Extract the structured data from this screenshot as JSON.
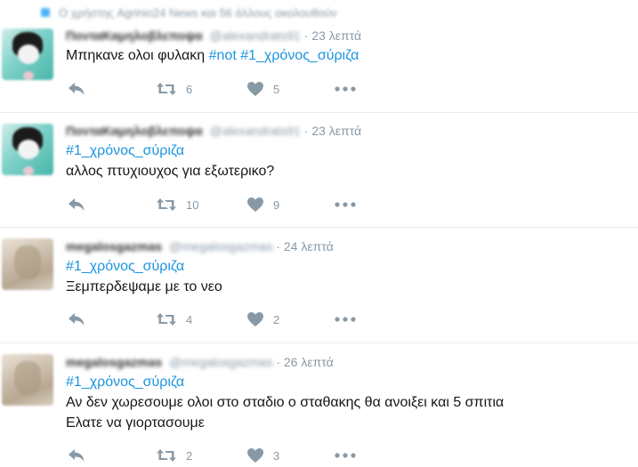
{
  "context": {
    "text": "Ο χρήστης Agrinio24 News και 56 άλλους ακολουθούν"
  },
  "colors": {
    "hashtag": "#1b95e0",
    "meta": "#8899a6",
    "text": "#14171a",
    "divider": "#e6ecf0"
  },
  "tweets": [
    {
      "name": "ΠονταΚαμηλοβλεποψα",
      "handle": "@alexandrats91",
      "time": "· 23 λεπτά",
      "line1_text": "Μπηκανε ολοι φυλακη ",
      "line1_tag1": "#not",
      "line1_space": " ",
      "line1_tag2": "#1_χρόνος_σύριζα",
      "retweets": "6",
      "likes": "5"
    },
    {
      "name": "ΠονταΚαμηλοβλεποψα",
      "handle": "@alexandrats91",
      "time": "· 23 λεπτά",
      "hashtag": "#1_χρόνος_σύριζα",
      "line2": "αλλος πτυχιουχος για εξωτερικο?",
      "retweets": "10",
      "likes": "9"
    },
    {
      "name": "megalosgazmas",
      "handle": "@megalosgazmas",
      "time": "· 24 λεπτά",
      "hashtag": "#1_χρόνος_σύριζα",
      "line2": "Ξεμπερδεψαμε με το νεο",
      "retweets": "4",
      "likes": "2"
    },
    {
      "name": "megalosgazmas",
      "handle": "@megalosgazmas",
      "time": "· 26 λεπτά",
      "hashtag": "#1_χρόνος_σύριζα",
      "line2": "Αν δεν χωρεσουμε ολοι στο σταδιο ο σταθακης θα ανοιξει και 5 σπιτια",
      "line3": "Ελατε να γιορτασουμε",
      "retweets": "2",
      "likes": "3"
    }
  ]
}
